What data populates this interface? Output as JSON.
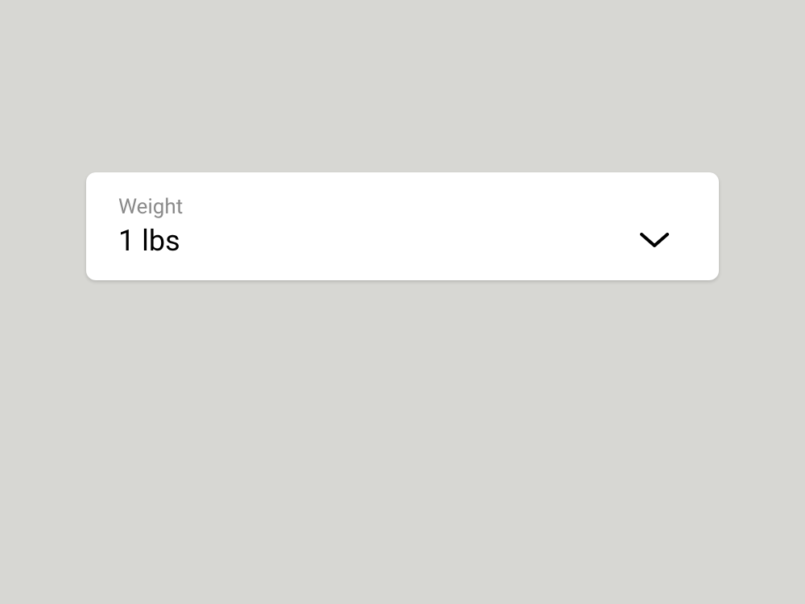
{
  "dropdown": {
    "label": "Weight",
    "value": "1 lbs"
  }
}
